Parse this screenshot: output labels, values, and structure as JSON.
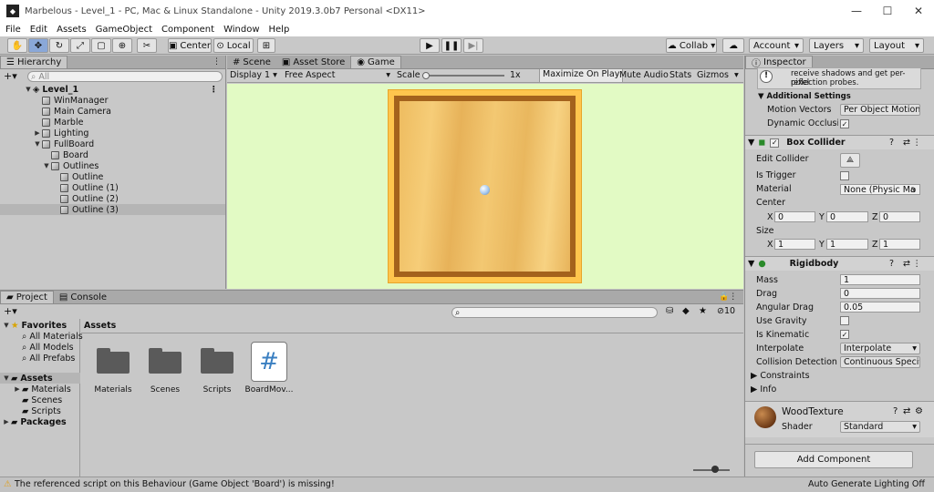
{
  "window": {
    "title": "Marbelous - Level_1 - PC, Mac & Linux Standalone - Unity 2019.3.0b7 Personal <DX11>"
  },
  "menu": [
    "File",
    "Edit",
    "Assets",
    "GameObject",
    "Component",
    "Window",
    "Help"
  ],
  "toolbar": {
    "center": "Center",
    "local": "Local",
    "collab": "Collab",
    "account": "Account",
    "layers": "Layers",
    "layout": "Layout"
  },
  "hierarchy": {
    "tab": "Hierarchy",
    "search_placeholder": "All",
    "scene": "Level_1",
    "items": [
      {
        "label": "WinManager",
        "depth": 1,
        "arrow": ""
      },
      {
        "label": "Main Camera",
        "depth": 1,
        "arrow": ""
      },
      {
        "label": "Marble",
        "depth": 1,
        "arrow": ""
      },
      {
        "label": "Lighting",
        "depth": 1,
        "arrow": "▶"
      },
      {
        "label": "FullBoard",
        "depth": 1,
        "arrow": "▼"
      },
      {
        "label": "Board",
        "depth": 2,
        "arrow": ""
      },
      {
        "label": "Outlines",
        "depth": 2,
        "arrow": "▼"
      },
      {
        "label": "Outline",
        "depth": 3,
        "arrow": ""
      },
      {
        "label": "Outline (1)",
        "depth": 3,
        "arrow": ""
      },
      {
        "label": "Outline (2)",
        "depth": 3,
        "arrow": ""
      },
      {
        "label": "Outline (3)",
        "depth": 3,
        "arrow": ""
      }
    ]
  },
  "scene_tabs": {
    "scene": "Scene",
    "asset_store": "Asset Store",
    "game": "Game"
  },
  "game_bar": {
    "display": "Display 1",
    "aspect": "Free Aspect",
    "scale_label": "Scale",
    "scale_value": "1x",
    "maximize": "Maximize On Play",
    "mute": "Mute Audio",
    "stats": "Stats",
    "gizmos": "Gizmos"
  },
  "project": {
    "tab": "Project",
    "console_tab": "Console",
    "count": "10",
    "favorites": "Favorites",
    "fav_items": [
      "All Materials",
      "All Models",
      "All Prefabs"
    ],
    "assets": "Assets",
    "asset_folders": [
      "Materials",
      "Scenes",
      "Scripts"
    ],
    "packages": "Packages",
    "breadcrumb": "Assets",
    "grid": [
      {
        "label": "Materials",
        "kind": "folder"
      },
      {
        "label": "Scenes",
        "kind": "folder"
      },
      {
        "label": "Scripts",
        "kind": "folder"
      },
      {
        "label": "BoardMov...",
        "kind": "script"
      }
    ]
  },
  "inspector": {
    "tab": "Inspector",
    "info_text_1": "receive shadows and get per-pixel",
    "info_text_2": "reflection probes.",
    "additional_settings": "Additional Settings",
    "motion_vectors_label": "Motion Vectors",
    "motion_vectors_value": "Per Object Motion",
    "dynamic_occlusion_label": "Dynamic Occlusion",
    "box_collider": {
      "title": "Box Collider",
      "edit": "Edit Collider",
      "trigger": "Is Trigger",
      "material": "Material",
      "material_value": "None (Physic Ma",
      "center": "Center",
      "size": "Size",
      "center_xyz": [
        "0",
        "0",
        "0"
      ],
      "size_xyz": [
        "1",
        "1",
        "1"
      ]
    },
    "rigidbody": {
      "title": "Rigidbody",
      "mass_label": "Mass",
      "mass": "1",
      "drag_label": "Drag",
      "drag": "0",
      "angular_label": "Angular Drag",
      "angular": "0.05",
      "gravity": "Use Gravity",
      "kinematic": "Is Kinematic",
      "interpolate_label": "Interpolate",
      "interpolate": "Interpolate",
      "collision_label": "Collision Detection",
      "collision": "Continuous Speci",
      "constraints": "Constraints",
      "info": "Info"
    },
    "material": {
      "name": "WoodTexture",
      "shader_label": "Shader",
      "shader": "Standard"
    },
    "add_component": "Add Component"
  },
  "status": {
    "message": "The referenced script on this Behaviour (Game Object 'Board') is missing!",
    "lighting": "Auto Generate Lighting Off"
  },
  "colors": {
    "game_bg": "#e2fac4",
    "wood": "#f0c368",
    "selection": "#b5b5b5",
    "warning": "#e0a020"
  }
}
